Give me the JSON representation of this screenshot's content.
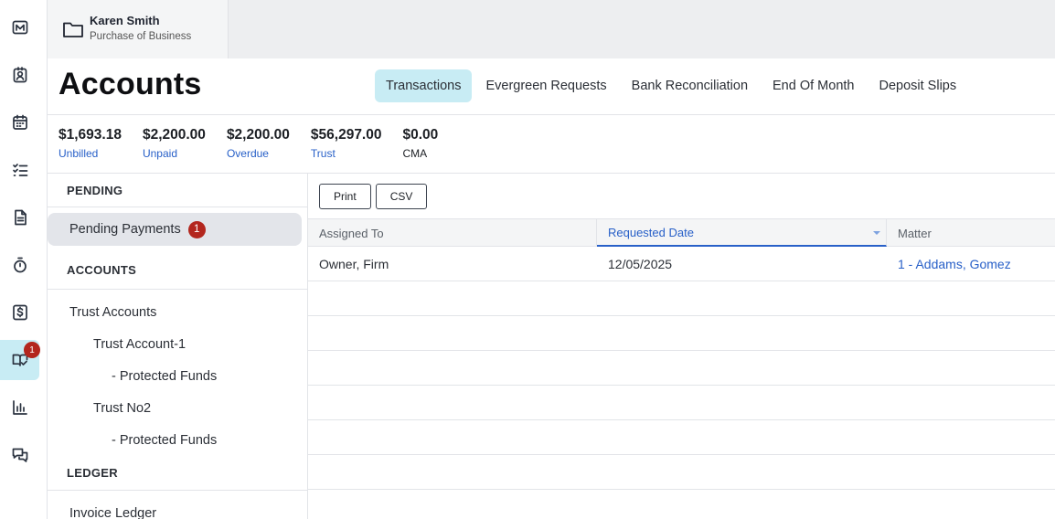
{
  "rail": {
    "items": [
      {
        "icon": "brand-m-icon"
      },
      {
        "icon": "contacts-icon"
      },
      {
        "icon": "calendar-icon"
      },
      {
        "icon": "tasks-icon"
      },
      {
        "icon": "document-icon"
      },
      {
        "icon": "timer-icon"
      },
      {
        "icon": "billing-dollar-icon"
      },
      {
        "icon": "accounts-book-icon",
        "active": true,
        "badge": "1"
      },
      {
        "icon": "reports-chart-icon"
      },
      {
        "icon": "messages-icon"
      }
    ]
  },
  "client": {
    "name": "Karen Smith",
    "matter_type": "Purchase of Business"
  },
  "page": {
    "title": "Accounts"
  },
  "tabs": [
    {
      "label": "Transactions",
      "active": true
    },
    {
      "label": "Evergreen Requests"
    },
    {
      "label": "Bank Reconciliation"
    },
    {
      "label": "End Of Month"
    },
    {
      "label": "Deposit Slips"
    }
  ],
  "summary": [
    {
      "value": "$1,693.18",
      "label": "Unbilled"
    },
    {
      "value": "$2,200.00",
      "label": "Unpaid"
    },
    {
      "value": "$2,200.00",
      "label": "Overdue"
    },
    {
      "value": "$56,297.00",
      "label": "Trust"
    },
    {
      "value": "$0.00",
      "label": "CMA"
    }
  ],
  "nav": {
    "pending_header": "PENDING",
    "pending_payments": {
      "label": "Pending Payments",
      "count": "1"
    },
    "accounts_header": "ACCOUNTS",
    "trust_accounts": "Trust Accounts",
    "trust_account_1": "Trust Account-1",
    "protected_funds_1": "- Protected Funds",
    "trust_no2": "Trust No2",
    "protected_funds_2": "- Protected Funds",
    "ledger_header": "LEDGER",
    "invoice_ledger": "Invoice Ledger"
  },
  "toolbar": {
    "print_label": "Print",
    "csv_label": "CSV"
  },
  "table": {
    "columns": [
      "Assigned To",
      "Requested Date",
      "Matter"
    ],
    "sorted_column": "Requested Date",
    "rows": [
      {
        "assigned_to": "Owner, Firm",
        "requested_date": "12/05/2025",
        "matter": "1 - Addams, Gomez"
      }
    ]
  },
  "colors": {
    "accent": "#c8ecf4",
    "link": "#2860c8",
    "badge": "#b3261e"
  }
}
